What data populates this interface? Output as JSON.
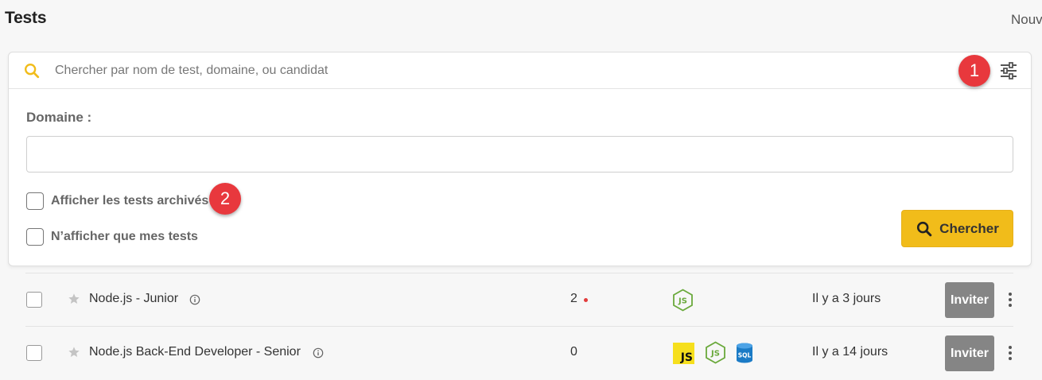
{
  "header": {
    "title": "Tests",
    "new_button_label": "Nouv"
  },
  "search": {
    "placeholder": "Chercher par nom de test, domaine, ou candidat",
    "value": ""
  },
  "filters": {
    "domain_label": "Domaine :",
    "domain_value": "",
    "archived_label": "Afficher les tests archivés",
    "archived_checked": false,
    "mine_label": "N’afficher que mes tests",
    "mine_checked": false,
    "search_button_label": "Chercher"
  },
  "annotations": {
    "badge_1": "1",
    "badge_2": "2"
  },
  "tests": [
    {
      "name": "Node.js - Junior",
      "count": "2",
      "has_notification": true,
      "technologies": [
        "nodejs-icon"
      ],
      "date": "Il y a 3 jours",
      "invite_label": "Inviter"
    },
    {
      "name": "Node.js Back-End Developer - Senior",
      "count": "0",
      "has_notification": false,
      "technologies": [
        "javascript-icon",
        "nodejs-icon",
        "sql-database-icon"
      ],
      "date": "Il y a 14 jours",
      "invite_label": "Inviter"
    }
  ],
  "colors": {
    "accent_yellow": "#f1bc1a",
    "badge_red": "#e8383d",
    "nodejs_green": "#6aa93b",
    "javascript_yellow": "#f6df1d",
    "sql_blue": "#1b7bc6",
    "invite_gray": "#858585"
  },
  "icons": {
    "js_text": "JS",
    "sql_text": "SQL"
  }
}
